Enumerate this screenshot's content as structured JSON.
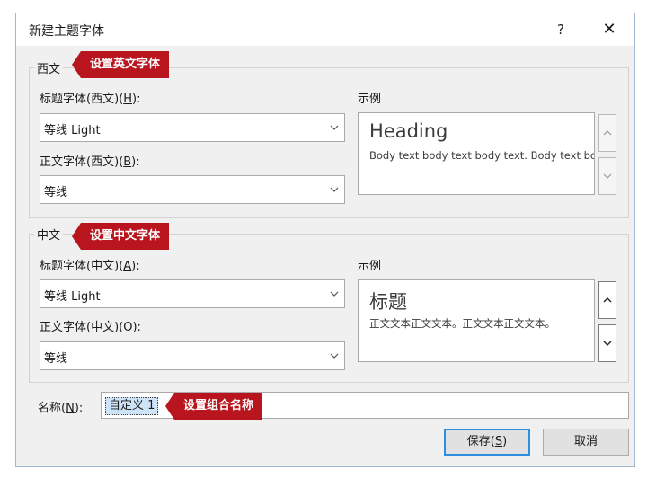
{
  "window": {
    "title": "新建主题字体",
    "help_icon": "?",
    "close_icon": "✕"
  },
  "western": {
    "legend": "西文",
    "heading_label": {
      "text": "标题字体(西文)(",
      "key": "H",
      "suffix": "):"
    },
    "heading_value": "等线 Light",
    "body_label": {
      "text": "正文字体(西文)(",
      "key": "B",
      "suffix": "):"
    },
    "body_value": "等线",
    "sample_label": "示例",
    "sample_heading": "Heading",
    "sample_body": "Body text body text body text. Body text body"
  },
  "chinese": {
    "legend": "中文",
    "heading_label": {
      "text": "标题字体(中文)(",
      "key": "A",
      "suffix": "):"
    },
    "heading_value": "等线 Light",
    "body_label": {
      "text": "正文字体(中文)(",
      "key": "O",
      "suffix": "):"
    },
    "body_value": "等线",
    "sample_label": "示例",
    "sample_heading": "标题",
    "sample_body": "正文文本正文文本。正文文本正文文本。"
  },
  "name": {
    "label": "名称(",
    "key": "N",
    "suffix": "):",
    "value": "自定义 1"
  },
  "buttons": {
    "save": {
      "text": "保存(",
      "key": "S",
      "suffix": ")"
    },
    "cancel": "取消"
  },
  "annotations": {
    "western": "设置英文字体",
    "chinese": "设置中文字体",
    "name": "设置组合名称"
  },
  "colors": {
    "annotation": "#b9151f",
    "primary_border": "#2f8ee0",
    "selection": "#cde3f7"
  }
}
